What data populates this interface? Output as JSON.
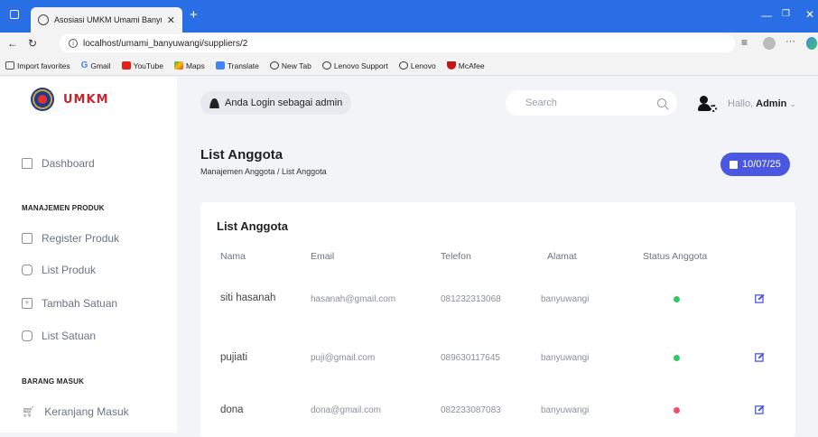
{
  "browser": {
    "tab_title": "Asosiasi UMKM Umami Banyuwangi",
    "url": "localhost/umami_banyuwangi/suppliers/2",
    "favorites": [
      "Import favorites",
      "Gmail",
      "YouTube",
      "Maps",
      "Translate",
      "New Tab",
      "Lenovo Support",
      "Lenovo",
      "McAfee"
    ]
  },
  "sidebar": {
    "logo_text": "UMKM",
    "dashboard_label": "Dashboard",
    "section1": "MANAJEMEN PRODUK",
    "items1": [
      "Register Produk",
      "List Produk",
      "Tambah Satuan",
      "List Satuan"
    ],
    "section2": "BARANG MASUK",
    "items2": [
      "Keranjang Masuk"
    ]
  },
  "header": {
    "login_text": "Anda Login sebagai admin",
    "search_placeholder": "Search",
    "hallo": "Hallo,",
    "user": "Admin"
  },
  "page": {
    "title": "List Anggota",
    "breadcrumb": "Manajemen Anggota / List Anggota",
    "date": "10/07/25"
  },
  "table": {
    "title": "List Anggota",
    "headers": [
      "Nama",
      "Email",
      "Telefon",
      "Alamat",
      "Status Anggota"
    ],
    "rows": [
      {
        "nama": "siti hasanah",
        "email": "hasanah@gmail.com",
        "telefon": "081232313068",
        "alamat": "banyuwangi",
        "status": "active"
      },
      {
        "nama": "pujiati",
        "email": "puji@gmail.com",
        "telefon": "089630117645",
        "alamat": "banyuwangi",
        "status": "active"
      },
      {
        "nama": "dona",
        "email": "dona@gmail.com",
        "telefon": "082233087083",
        "alamat": "banyuwangi",
        "status": "inactive"
      }
    ]
  },
  "colors": {
    "active": "#2ec866",
    "inactive": "#f0506e",
    "accent": "#4a57e0",
    "edit_icon": "#4a57e0",
    "browser_bar": "#2a6ee6"
  }
}
